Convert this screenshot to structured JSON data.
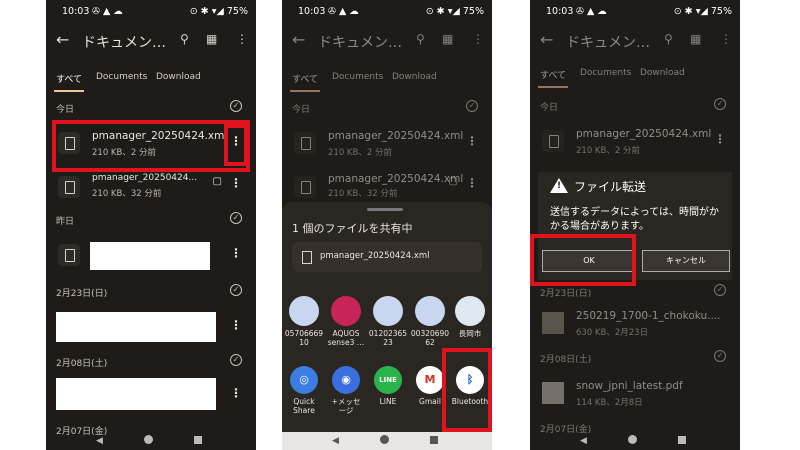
{
  "status": {
    "time": "10:03",
    "left_icons": "✇ ▲ ☁",
    "right_icons": "⊙ ✱ ▾◢",
    "battery": "75%"
  },
  "appbar": {
    "title": "ドキュメン…"
  },
  "tabs": [
    "すべて",
    "Documents",
    "Download"
  ],
  "screen1": {
    "sections": {
      "today": "今日",
      "yesterday": "昨日",
      "feb23": "2月23日(日)",
      "feb08": "2月08日(土)",
      "feb07": "2月07日(金)"
    },
    "file1": {
      "name": "pmanager_20250424.xml",
      "meta": "210 KB、2 分前"
    },
    "file2": {
      "name": "pmanager_20250424...",
      "meta": "210 KB、32 分前"
    }
  },
  "screen2": {
    "file1": {
      "name": "pmanager_20250424.xml",
      "meta": "210 KB、2 分前"
    },
    "file2": {
      "name": "pmanager_20250424.xml",
      "meta": "210 KB、32 分前"
    },
    "sheet_title": "1 個のファイルを共有中",
    "shared_file": "pmanager_20250424.xml",
    "contacts": [
      {
        "name": "05706669\n10",
        "color": "#c8d6f0"
      },
      {
        "name": "AQUOS\nsense3 …",
        "color": "#c8245a"
      },
      {
        "name": "01202365\n23",
        "color": "#c8d6f0"
      },
      {
        "name": "00320690\n62",
        "color": "#c8d6f0"
      },
      {
        "name": "長岡市",
        "color": "#dfe8f0"
      }
    ],
    "apps": [
      {
        "name": "Quick\nShare",
        "glyph": "◎",
        "color": "#3b7de0"
      },
      {
        "name": "+メッセ\nージ",
        "glyph": "◉",
        "color": "#3b6fe0"
      },
      {
        "name": "LINE",
        "glyph": "LINE",
        "color": "#2ab34a"
      },
      {
        "name": "Gmail",
        "glyph": "M",
        "color": "#ffffff"
      },
      {
        "name": "Bluetooth",
        "glyph": "ᛒ",
        "color": "#ffffff"
      }
    ]
  },
  "screen3": {
    "sections": {
      "today": "今日",
      "feb23": "2月23日(日)",
      "feb08": "2月08日(土)",
      "feb07": "2月07日(金)"
    },
    "file1": {
      "name": "pmanager_20250424.xml",
      "meta": "210 KB、2 分前"
    },
    "file3": {
      "name": "250219_1700-1_chokoku....",
      "meta": "630 KB、2月23日"
    },
    "file4": {
      "name": "snow_jpni_latest.pdf",
      "meta": "114 KB、2月8日"
    },
    "dialog": {
      "title": "ファイル転送",
      "message": "送信するデータによっては、時間がかかる場合があります。",
      "ok": "OK",
      "cancel": "キャンセル"
    }
  },
  "colors": {
    "highlight": "#e0141e",
    "background": "#1e1b18",
    "accent": "#e8c79a"
  }
}
